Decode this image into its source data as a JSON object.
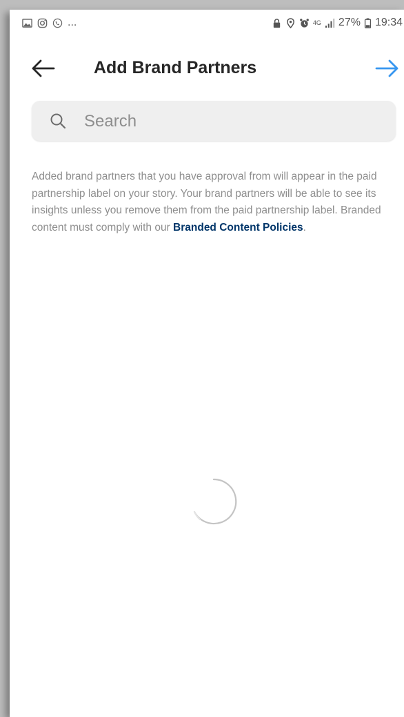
{
  "status_bar": {
    "left_dots": "...",
    "battery_percent": "27%",
    "time": "19:34",
    "network_label": "4G"
  },
  "header": {
    "title": "Add Brand Partners"
  },
  "search": {
    "placeholder": "Search",
    "value": ""
  },
  "description": {
    "text": "Added brand partners that you have approval from will appear in the paid partnership label on your story. Your brand partners will be able to see its insights unless you remove them from the paid partnership label. Branded content must comply with our ",
    "link_label": "Branded Content Policies",
    "suffix": "."
  },
  "colors": {
    "accent": "#3897f0",
    "link": "#003569",
    "text_primary": "#262626",
    "text_secondary": "#8e8e8e",
    "search_bg": "#efefef"
  },
  "icons": {
    "back": "arrow-left-icon",
    "next": "arrow-right-icon",
    "search": "search-icon",
    "loading": "spinner-icon"
  }
}
